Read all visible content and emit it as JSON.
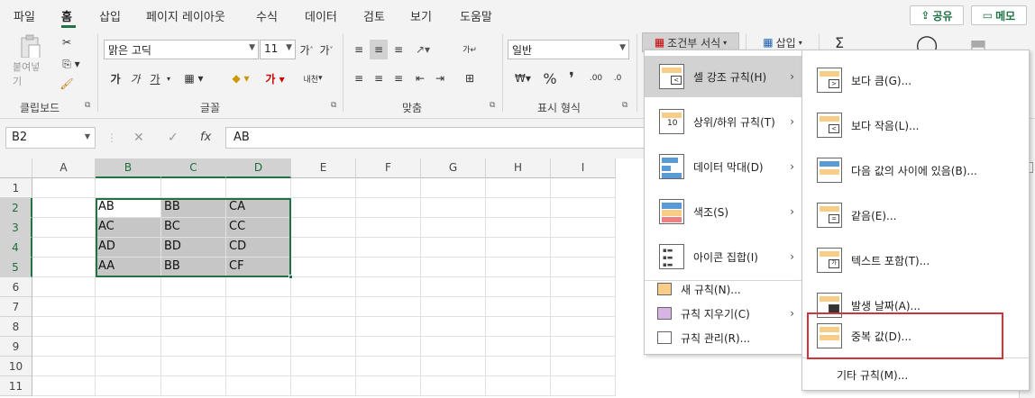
{
  "menubar": {
    "tabs": [
      "파일",
      "홈",
      "삽입",
      "페이지 레이아웃",
      "수식",
      "데이터",
      "검토",
      "보기",
      "도움말"
    ],
    "share_label": "공유",
    "memo_label": "메모"
  },
  "ribbon": {
    "clipboard": {
      "label": "클립보드",
      "paste_label": "붙여넣기"
    },
    "font": {
      "label": "글꼴",
      "font_name": "맑은 고딕",
      "font_size": "11",
      "bold": "가",
      "italic": "가",
      "underline": "가",
      "phonetic": "내천"
    },
    "align": {
      "label": "맞춤"
    },
    "number": {
      "label": "표시 형식",
      "format": "일반"
    },
    "styles": {
      "cond_format_label": "조건부 서식"
    },
    "cells": {
      "insert_label": "삽입"
    }
  },
  "formula_bar": {
    "name_box": "B2",
    "formula": "AB"
  },
  "sheet": {
    "columns": [
      "A",
      "B",
      "C",
      "D",
      "E",
      "F",
      "G",
      "H",
      "I"
    ],
    "rows": [
      "1",
      "2",
      "3",
      "4",
      "5",
      "6",
      "7",
      "8",
      "9",
      "10",
      "11"
    ],
    "cells": [
      [
        "AB",
        "BB",
        "CA"
      ],
      [
        "AC",
        "BC",
        "CC"
      ],
      [
        "AD",
        "BD",
        "CD"
      ],
      [
        "AA",
        "BB",
        "CF"
      ]
    ]
  },
  "cond_menu": {
    "items": [
      {
        "label": "셀 강조 규칙(H)"
      },
      {
        "label": "상위/하위 규칙(T)"
      },
      {
        "label": "데이터 막대(D)"
      },
      {
        "label": "색조(S)"
      },
      {
        "label": "아이콘 집합(I)"
      }
    ],
    "small_items": [
      {
        "label": "새 규칙(N)..."
      },
      {
        "label": "규칙 지우기(C)"
      },
      {
        "label": "규칙 관리(R)..."
      }
    ]
  },
  "highlight_menu": {
    "items": [
      {
        "label": "보다 큼(G)..."
      },
      {
        "label": "보다 작음(L)..."
      },
      {
        "label": "다음 값의 사이에 있음(B)..."
      },
      {
        "label": "같음(E)..."
      },
      {
        "label": "텍스트 포함(T)..."
      },
      {
        "label": "발생 날짜(A)..."
      },
      {
        "label": "중복 값(D)..."
      }
    ],
    "more_rules": "기타 규칙(M)..."
  },
  "colors": {
    "accent": "#217346",
    "highlight_box": "#d13438"
  }
}
